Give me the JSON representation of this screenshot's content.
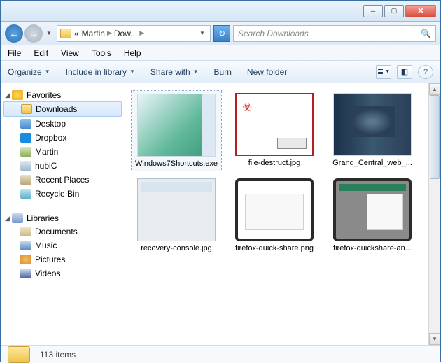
{
  "titlebar": {
    "min": "─",
    "max": "▢",
    "close": "✕"
  },
  "nav": {
    "back_arrow": "←",
    "fwd_arrow": "→",
    "crumb_prefix": "«",
    "crumb1": "Martin",
    "crumb2": "Dow...",
    "refresh": "↻"
  },
  "search": {
    "placeholder": "Search Downloads",
    "icon": "🔍"
  },
  "menu": {
    "file": "File",
    "edit": "Edit",
    "view": "View",
    "tools": "Tools",
    "help": "Help"
  },
  "toolbar": {
    "organize": "Organize",
    "include": "Include in library",
    "share": "Share with",
    "burn": "Burn",
    "newfolder": "New folder",
    "viewicon": "≣",
    "paneicon": "◧",
    "helpicon": "?"
  },
  "sidebar": {
    "favorites": "Favorites",
    "items_fav": [
      {
        "label": "Downloads",
        "icon": "ic-folder",
        "selected": true
      },
      {
        "label": "Desktop",
        "icon": "ic-desktop"
      },
      {
        "label": "Dropbox",
        "icon": "ic-dropbox"
      },
      {
        "label": "Martin",
        "icon": "ic-user"
      },
      {
        "label": "hubiC",
        "icon": "ic-hubic"
      },
      {
        "label": "Recent Places",
        "icon": "ic-recent"
      },
      {
        "label": "Recycle Bin",
        "icon": "ic-recycle"
      }
    ],
    "libraries": "Libraries",
    "items_lib": [
      {
        "label": "Documents",
        "icon": "ic-doc"
      },
      {
        "label": "Music",
        "icon": "ic-music"
      },
      {
        "label": "Pictures",
        "icon": "ic-pic"
      },
      {
        "label": "Videos",
        "icon": "ic-video"
      }
    ]
  },
  "files": [
    {
      "name": "Windows7Shortcuts.exe",
      "thumb": "th-win7",
      "selected": true
    },
    {
      "name": "file-destruct.jpg",
      "thumb": "th-filedestruct"
    },
    {
      "name": "Grand_Central_web_...",
      "thumb": "th-grandcentral"
    },
    {
      "name": "recovery-console.jpg",
      "thumb": "th-recovery"
    },
    {
      "name": "firefox-quick-share.png",
      "thumb": "th-firefoxqs"
    },
    {
      "name": "firefox-quickshare-an...",
      "thumb": "th-firefoxqsa"
    }
  ],
  "status": {
    "count": "113 items"
  }
}
